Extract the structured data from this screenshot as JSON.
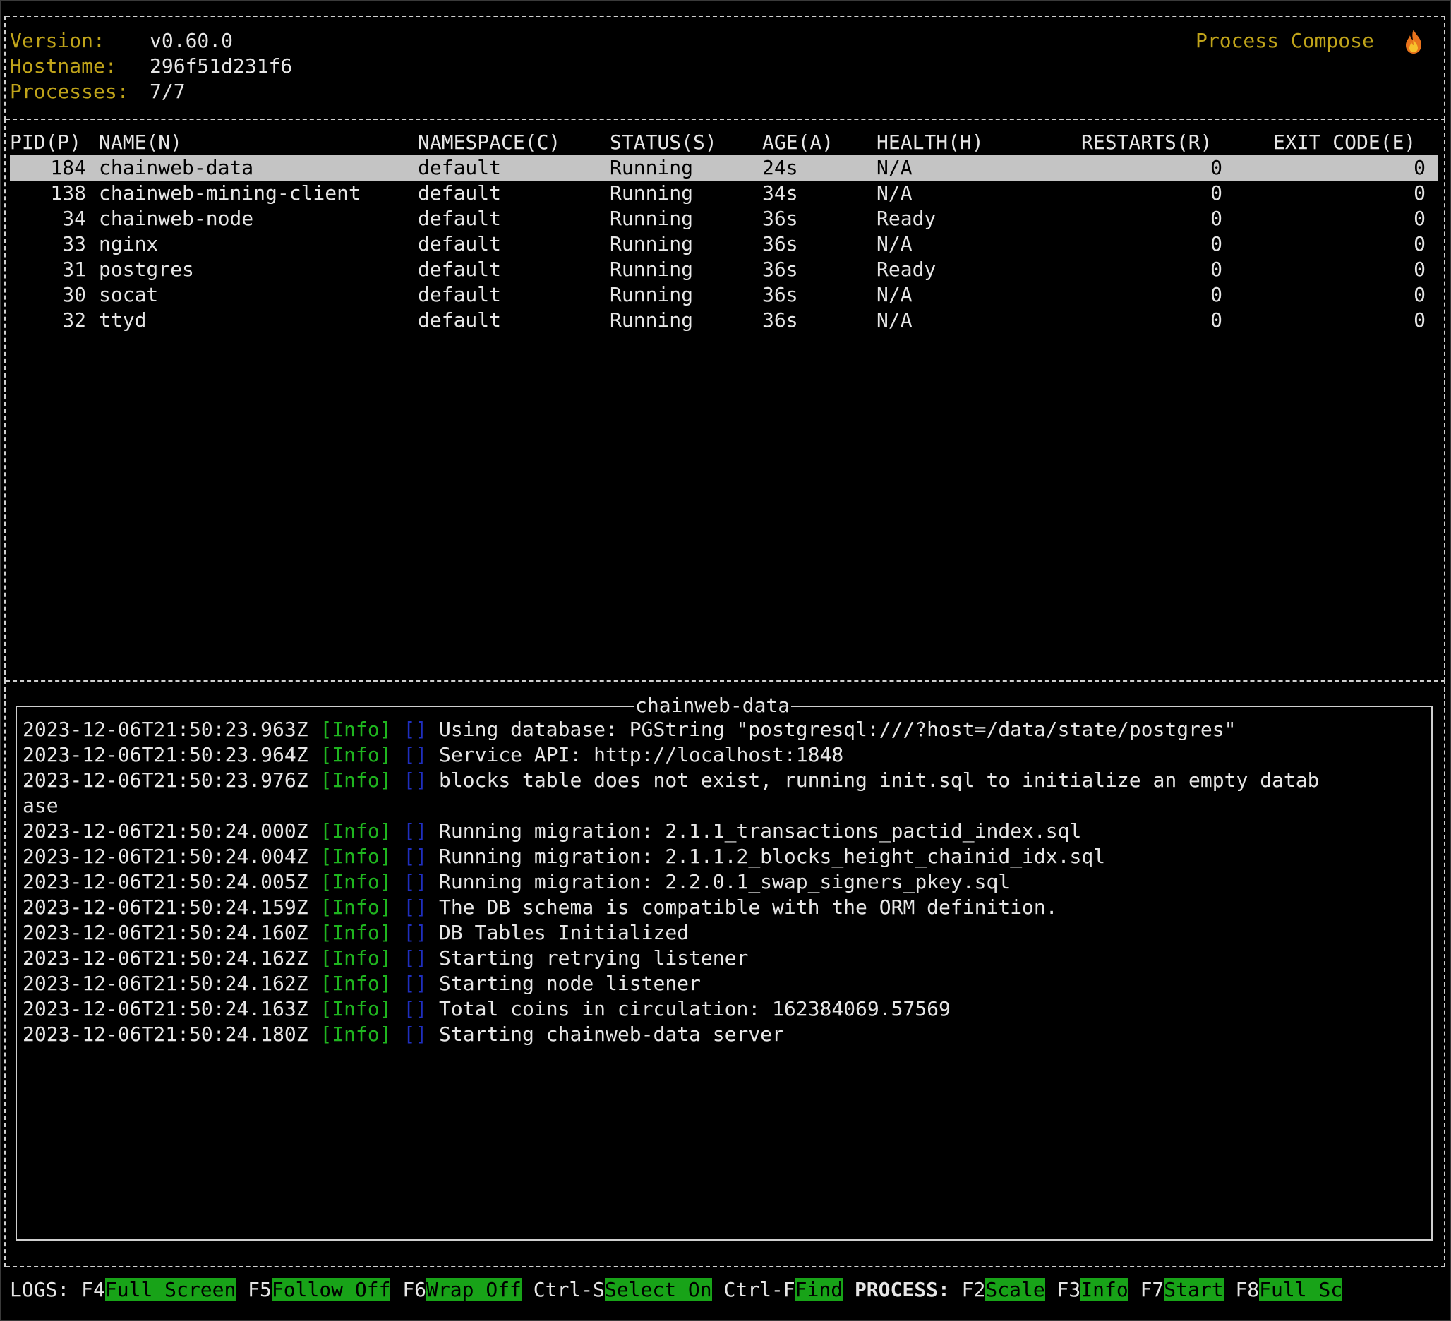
{
  "header": {
    "version_label": "Version:",
    "version_value": "v0.60.0",
    "hostname_label": "Hostname:",
    "hostname_value": "296f51d231f6",
    "processes_label": "Processes:",
    "processes_value": "7/7",
    "brand": "Process Compose",
    "brand_icon": "flame-icon"
  },
  "table": {
    "columns": {
      "pid": "PID(P)",
      "name": "NAME(N)",
      "namespace": "NAMESPACE(C)",
      "status": "STATUS(S)",
      "age": "AGE(A)",
      "health": "HEALTH(H)",
      "restarts": "RESTARTS(R)",
      "exit_code": "EXIT CODE(E)"
    },
    "rows": [
      {
        "pid": "184",
        "name": "chainweb-data",
        "namespace": "default",
        "status": "Running",
        "age": "24s",
        "health": "N/A",
        "restarts": "0",
        "exit_code": "0"
      },
      {
        "pid": "138",
        "name": "chainweb-mining-client",
        "namespace": "default",
        "status": "Running",
        "age": "34s",
        "health": "N/A",
        "restarts": "0",
        "exit_code": "0"
      },
      {
        "pid": "34",
        "name": "chainweb-node",
        "namespace": "default",
        "status": "Running",
        "age": "36s",
        "health": "Ready",
        "restarts": "0",
        "exit_code": "0"
      },
      {
        "pid": "33",
        "name": "nginx",
        "namespace": "default",
        "status": "Running",
        "age": "36s",
        "health": "N/A",
        "restarts": "0",
        "exit_code": "0"
      },
      {
        "pid": "31",
        "name": "postgres",
        "namespace": "default",
        "status": "Running",
        "age": "36s",
        "health": "Ready",
        "restarts": "0",
        "exit_code": "0"
      },
      {
        "pid": "30",
        "name": "socat",
        "namespace": "default",
        "status": "Running",
        "age": "36s",
        "health": "N/A",
        "restarts": "0",
        "exit_code": "0"
      },
      {
        "pid": "32",
        "name": "ttyd",
        "namespace": "default",
        "status": "Running",
        "age": "36s",
        "health": "N/A",
        "restarts": "0",
        "exit_code": "0"
      }
    ]
  },
  "logs": {
    "title": "chainweb-data",
    "lines": [
      {
        "ts": "2023-12-06T21:50:23.963Z",
        "level": "[Info]",
        "ctx": "[]",
        "msg": "Using database: PGString \"postgresql:///?host=/data/state/postgres\""
      },
      {
        "ts": "2023-12-06T21:50:23.964Z",
        "level": "[Info]",
        "ctx": "[]",
        "msg": "Service API: http://localhost:1848"
      },
      {
        "ts": "2023-12-06T21:50:23.976Z",
        "level": "[Info]",
        "ctx": "[]",
        "msg": "blocks table does not exist, running init.sql to initialize an empty datab"
      },
      {
        "ts": "",
        "level": "",
        "ctx": "",
        "msg": "ase"
      },
      {
        "ts": "2023-12-06T21:50:24.000Z",
        "level": "[Info]",
        "ctx": "[]",
        "msg": "Running migration: 2.1.1_transactions_pactid_index.sql"
      },
      {
        "ts": "2023-12-06T21:50:24.004Z",
        "level": "[Info]",
        "ctx": "[]",
        "msg": "Running migration: 2.1.1.2_blocks_height_chainid_idx.sql"
      },
      {
        "ts": "2023-12-06T21:50:24.005Z",
        "level": "[Info]",
        "ctx": "[]",
        "msg": "Running migration: 2.2.0.1_swap_signers_pkey.sql"
      },
      {
        "ts": "2023-12-06T21:50:24.159Z",
        "level": "[Info]",
        "ctx": "[]",
        "msg": "The DB schema is compatible with the ORM definition."
      },
      {
        "ts": "2023-12-06T21:50:24.160Z",
        "level": "[Info]",
        "ctx": "[]",
        "msg": "DB Tables Initialized"
      },
      {
        "ts": "2023-12-06T21:50:24.162Z",
        "level": "[Info]",
        "ctx": "[]",
        "msg": "Starting retrying listener"
      },
      {
        "ts": "2023-12-06T21:50:24.162Z",
        "level": "[Info]",
        "ctx": "[]",
        "msg": "Starting node listener"
      },
      {
        "ts": "2023-12-06T21:50:24.163Z",
        "level": "[Info]",
        "ctx": "[]",
        "msg": "Total coins in circulation: 162384069.57569"
      },
      {
        "ts": "2023-12-06T21:50:24.180Z",
        "level": "[Info]",
        "ctx": "[]",
        "msg": "Starting chainweb-data server"
      }
    ]
  },
  "footer": {
    "logs_section": "LOGS:",
    "process_section": "PROCESS:",
    "keys": [
      {
        "key": "F4",
        "label": "Full Screen"
      },
      {
        "key": "F5",
        "label": "Follow Off"
      },
      {
        "key": "F6",
        "label": "Wrap Off"
      },
      {
        "key": "Ctrl-S",
        "label": "Select On"
      },
      {
        "key": "Ctrl-F",
        "label": "Find"
      },
      {
        "key": "F2",
        "label": "Scale"
      },
      {
        "key": "F3",
        "label": "Info"
      },
      {
        "key": "F7",
        "label": "Start"
      },
      {
        "key": "F8",
        "label": "Full Sc"
      }
    ]
  },
  "colors": {
    "header_label": "#c0a41a",
    "selected_row_bg": "#c4c4c4",
    "log_level": "#1fb51f",
    "log_context": "#1f2fbf",
    "footer_key_bg": "#18a318"
  }
}
